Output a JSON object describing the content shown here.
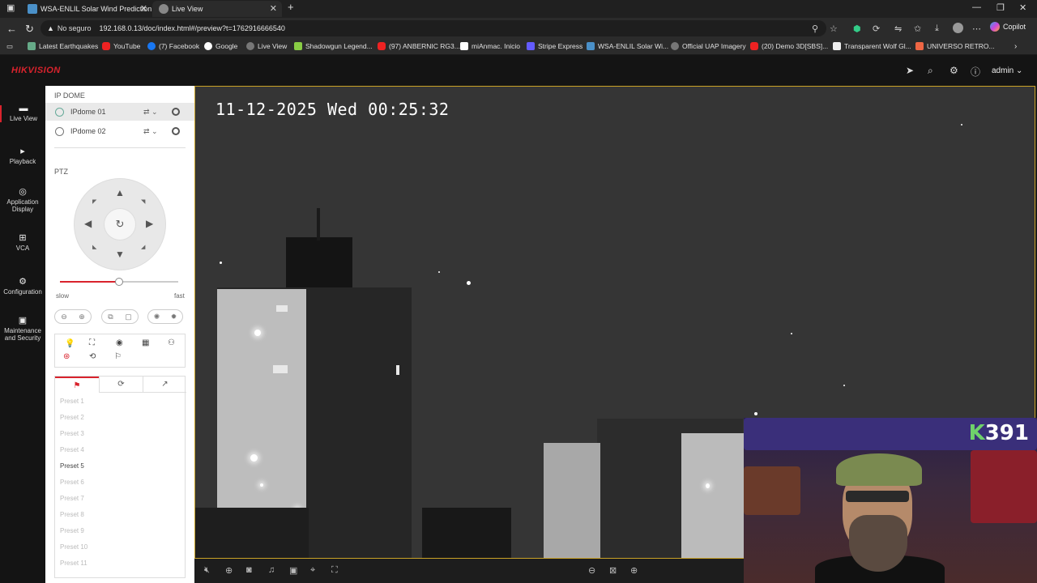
{
  "browser": {
    "tabs": [
      {
        "title": "WSA-ENLIL Solar Wind Prediction"
      },
      {
        "title": "Live View"
      }
    ],
    "security_label": "No seguro",
    "url": "192.168.0.13/doc/index.html#/preview?t=1762916666540",
    "copilot_label": "Copilot",
    "bookmarks": [
      "Latest Earthquakes",
      "YouTube",
      "(7) Facebook",
      "Google",
      "Live View",
      "Shadowgun Legend...",
      "(97) ANBERNIC RG3...",
      "miAnmac. Inicio",
      "Stripe Express",
      "WSA-ENLIL Solar Wi...",
      "Official UAP Imagery",
      "(20) Demo 3D[SBS]...",
      "Transparent Wolf Gl...",
      "UNIVERSO RETRO..."
    ]
  },
  "app": {
    "brand": "HIKVISION",
    "user": "admin"
  },
  "leftnav": [
    {
      "label": "Live View",
      "icon": "monitor-icon"
    },
    {
      "label": "Playback",
      "icon": "playback-icon"
    },
    {
      "label": "Application Display",
      "icon": "application-icon"
    },
    {
      "label": "VCA",
      "icon": "vca-icon"
    },
    {
      "label": "Configuration",
      "icon": "gear-icon"
    },
    {
      "label": "Maintenance and Security",
      "icon": "maintenance-icon"
    }
  ],
  "panel": {
    "cameras_title": "IP DOME",
    "cameras": [
      {
        "name": "IPdome 01"
      },
      {
        "name": "IPdome 02"
      }
    ],
    "ptz_title": "PTZ",
    "speed_slow": "slow",
    "speed_fast": "fast",
    "speed_level": 0.5,
    "presets": [
      {
        "label": "Preset 1",
        "active": false
      },
      {
        "label": "Preset 2",
        "active": false
      },
      {
        "label": "Preset 3",
        "active": false
      },
      {
        "label": "Preset 4",
        "active": false
      },
      {
        "label": "Preset 5",
        "active": true
      },
      {
        "label": "Preset 6",
        "active": false
      },
      {
        "label": "Preset 7",
        "active": false
      },
      {
        "label": "Preset 8",
        "active": false
      },
      {
        "label": "Preset 9",
        "active": false
      },
      {
        "label": "Preset 10",
        "active": false
      },
      {
        "label": "Preset 11",
        "active": false
      }
    ]
  },
  "video": {
    "osd_timestamp": "11-12-2025 Wed 00:25:32"
  },
  "webcam": {
    "badge_letter": "K",
    "badge_number": "391"
  },
  "colors": {
    "accent": "#d9232d",
    "video_border": "#c9a227"
  }
}
